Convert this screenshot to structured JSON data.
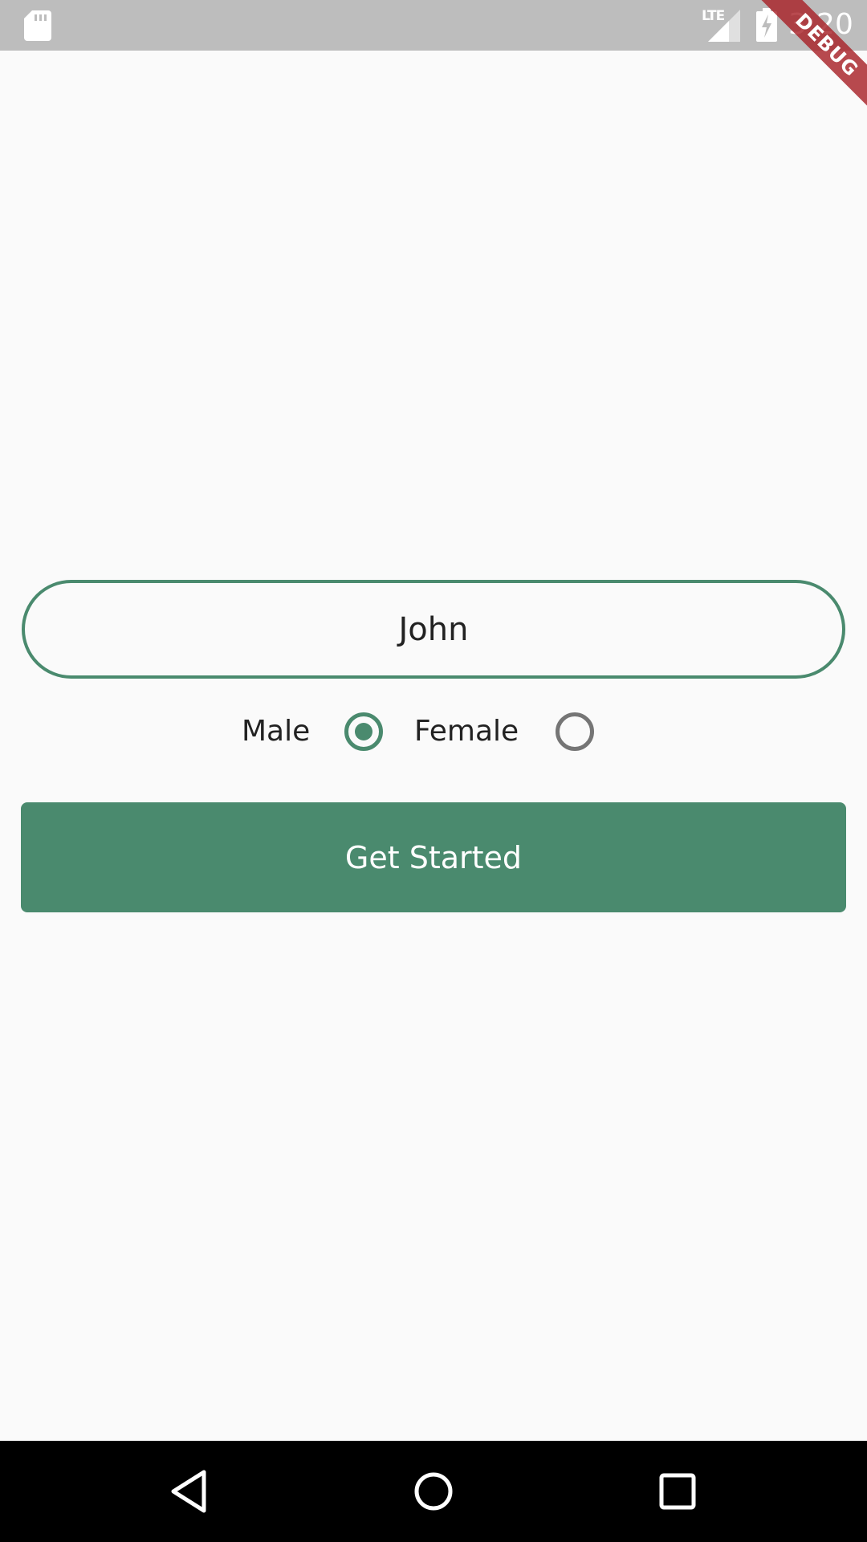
{
  "status_bar": {
    "time": "3:20",
    "network_label": "LTE",
    "icons": [
      "sd-card-icon",
      "signal-icon",
      "battery-charging-icon"
    ]
  },
  "debug_banner": "DEBUG",
  "form": {
    "name_value": "John",
    "gender_options": [
      {
        "label": "Male",
        "selected": true
      },
      {
        "label": "Female",
        "selected": false
      }
    ],
    "submit_label": "Get Started"
  },
  "nav_bar": {
    "icons": [
      "back-icon",
      "home-icon",
      "recents-icon"
    ]
  },
  "colors": {
    "accent": "#4a8a6e",
    "background": "#fafafa",
    "status_bar": "#bdbdbd",
    "unselected_radio": "#757575",
    "debug_ribbon": "#a82228"
  }
}
